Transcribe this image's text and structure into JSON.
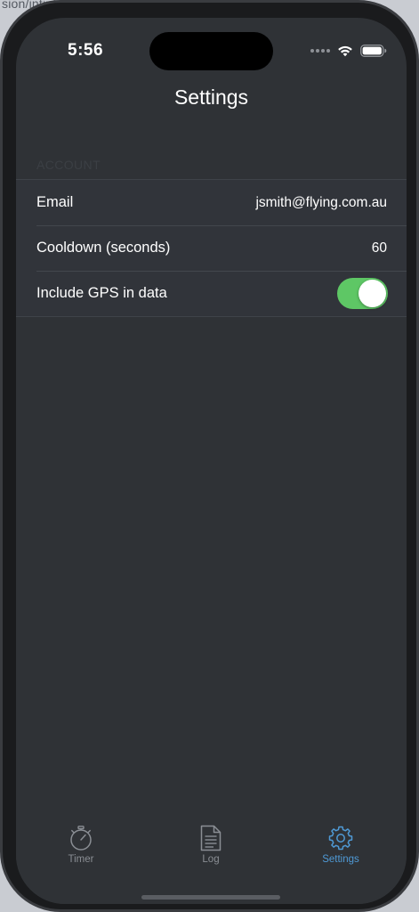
{
  "backdrop": {
    "text": "sion/intint"
  },
  "status_bar": {
    "time": "5:56",
    "icons": [
      "signal-dots-icon",
      "wifi-icon",
      "battery-icon"
    ]
  },
  "nav": {
    "title": "Settings"
  },
  "section": {
    "header": "ACCOUNT"
  },
  "settings": {
    "email_label": "Email",
    "email_value": "jsmith@flying.com.au",
    "cooldown_label": "Cooldown (seconds)",
    "cooldown_value": "60",
    "gps_label": "Include GPS in data",
    "gps_enabled": true
  },
  "tabs": [
    {
      "label": "Timer",
      "icon": "stopwatch-icon",
      "active": false
    },
    {
      "label": "Log",
      "icon": "document-icon",
      "active": false
    },
    {
      "label": "Settings",
      "icon": "gear-icon",
      "active": true
    }
  ],
  "colors": {
    "background": "#2f3236",
    "toggle_on": "#5ec765",
    "tab_active": "#4f9ad6",
    "tab_inactive": "#8a8e94"
  }
}
